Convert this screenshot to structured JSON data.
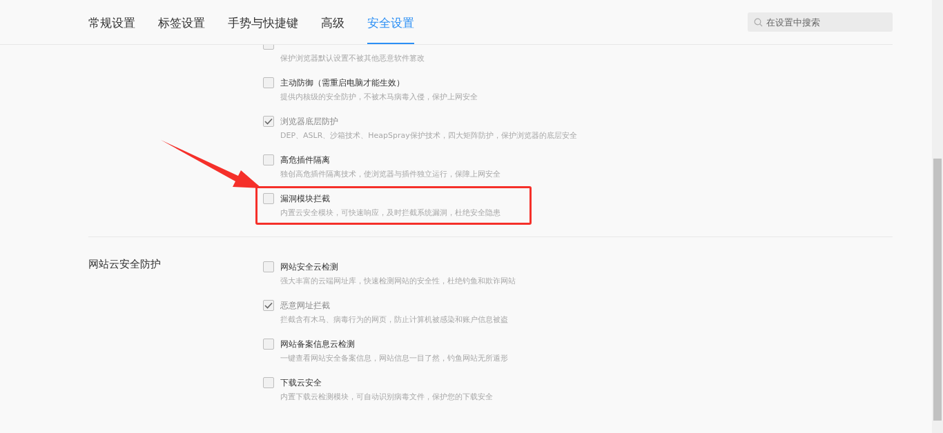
{
  "tabs": [
    {
      "label": "常规设置",
      "selected": false
    },
    {
      "label": "标签设置",
      "selected": false
    },
    {
      "label": "手势与快捷键",
      "selected": false
    },
    {
      "label": "高级",
      "selected": false
    },
    {
      "label": "安全设置",
      "selected": true
    }
  ],
  "search": {
    "placeholder": "在设置中搜索"
  },
  "sections": [
    {
      "items": [
        {
          "checked": false,
          "highlighted": false,
          "description": "保护浏览器默认设置不被其他恶意软件篡改"
        },
        {
          "title": "主动防御（需重启电脑才能生效）",
          "checked": false,
          "highlighted": false,
          "description": "提供内核级的安全防护，不被木马病毒入侵，保护上网安全"
        },
        {
          "title": "浏览器底层防护",
          "checked": true,
          "highlighted": false,
          "description": "DEP、ASLR、沙箱技术、HeapSpray保护技术，四大矩阵防护，保护浏览器的底层安全"
        },
        {
          "title": "高危插件隔离",
          "checked": false,
          "highlighted": false,
          "description": "独创高危插件隔离技术，使浏览器与插件独立运行，保障上网安全"
        },
        {
          "title": "漏洞模块拦截",
          "checked": false,
          "highlighted": true,
          "description": "内置云安全模块，可快速响应，及时拦截系统漏洞，杜绝安全隐患"
        }
      ]
    },
    {
      "title": "网站云安全防护",
      "items": [
        {
          "title": "网站安全云检测",
          "checked": false,
          "highlighted": false,
          "description": "强大丰富的云端网址库，快速检测网站的安全性，杜绝钓鱼和欺诈网站"
        },
        {
          "title": "恶意网址拦截",
          "checked": true,
          "highlighted": false,
          "description": "拦截含有木马、病毒行为的网页，防止计算机被感染和账户信息被盗"
        },
        {
          "title": "网站备案信息云检测",
          "checked": false,
          "highlighted": false,
          "description": "一键查看网站安全备案信息，网站信息一目了然，钓鱼网站无所遁形"
        },
        {
          "title": "下载云安全",
          "checked": false,
          "highlighted": false,
          "description": "内置下载云检测模块，可自动识别病毒文件，保护您的下载安全"
        }
      ]
    }
  ]
}
